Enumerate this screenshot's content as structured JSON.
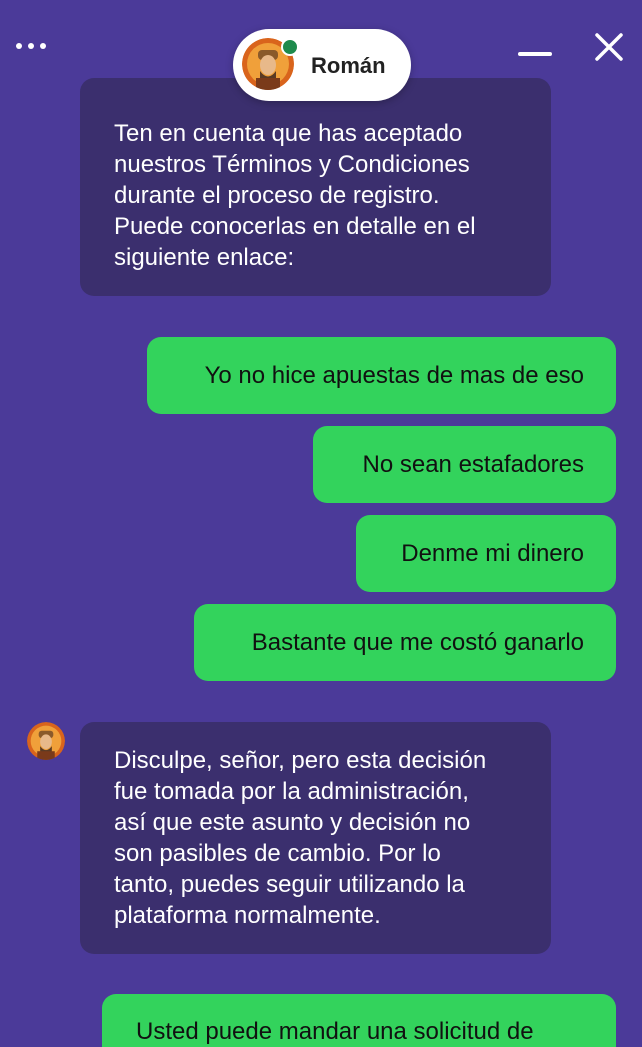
{
  "header": {
    "agent_name": "Román",
    "menu_icon": "more-dots-icon",
    "minimize_icon": "minimize-icon",
    "close_icon": "close-icon",
    "status": "online"
  },
  "colors": {
    "background": "#4b3a99",
    "agent_bubble": "#3b2f6e",
    "user_bubble": "#33d35c",
    "online": "#1e8a4c"
  },
  "messages": [
    {
      "sender": "agent",
      "lines": [
        "Ten en cuenta que has aceptado",
        "nuestros Términos y Condiciones",
        "durante el proceso de registro.",
        "Puede conocerlas en detalle en el",
        "siguiente enlace:"
      ]
    },
    {
      "sender": "user",
      "text": "Yo no hice apuestas de mas de eso"
    },
    {
      "sender": "user",
      "text": "No sean estafadores"
    },
    {
      "sender": "user",
      "text": "Denme mi dinero"
    },
    {
      "sender": "user",
      "text": "Bastante que me costó ganarlo"
    },
    {
      "sender": "agent",
      "lines": [
        "Disculpe, señor, pero esta decisión",
        "fue tomada por la administración,",
        "así que este asunto y decisión no",
        "son pasibles de cambio. Por lo",
        "tanto, puedes seguir utilizando la",
        "plataforma normalmente."
      ]
    },
    {
      "sender": "user",
      "text": "Usted puede mandar una solicitud de"
    }
  ]
}
